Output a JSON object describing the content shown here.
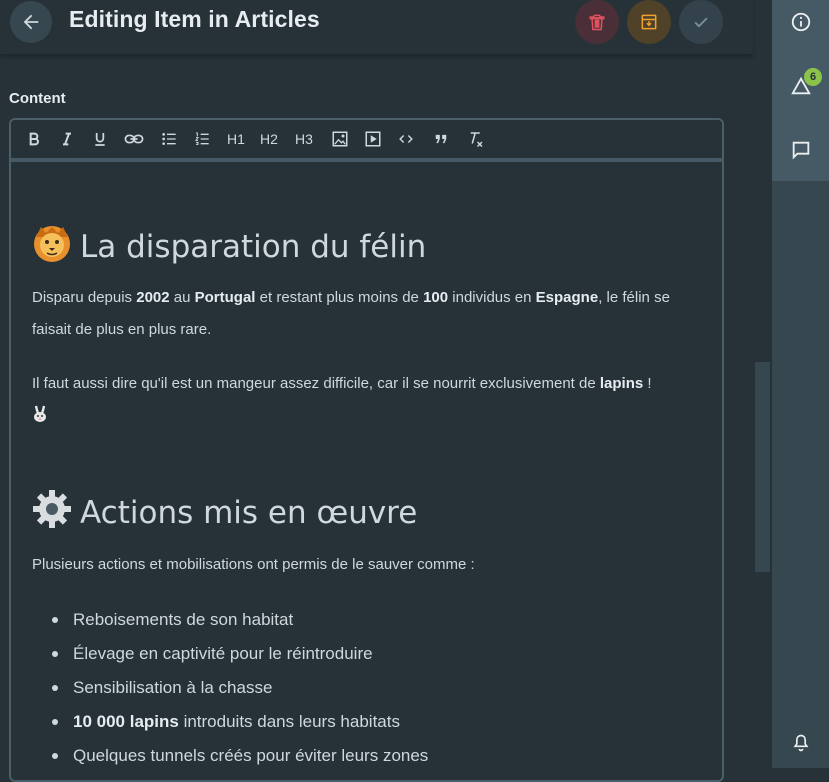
{
  "header": {
    "title": "Editing Item in Articles"
  },
  "sidebar": {
    "notifications_count": "6"
  },
  "content_label": "Content",
  "toolbar": {
    "h1": "H1",
    "h2": "H2",
    "h3": "H3"
  },
  "doc": {
    "section1": {
      "emoji": "lion-face-emoji",
      "heading": "La disparation du félin",
      "p1": [
        "Disparu depuis ",
        "2002",
        " au ",
        "Portugal",
        " et restant plus moins de ",
        "100",
        " individus en ",
        "Espagne",
        ", le félin se faisait de plus en plus rare."
      ],
      "p2": [
        "Il faut aussi dire qu'il est un mangeur assez difficile, car il se nourrit exclusivement de ",
        "lapins",
        " !"
      ],
      "p2_emoji": "rabbit-emoji"
    },
    "section2": {
      "emoji": "gear-emoji",
      "heading": "Actions mis en œuvre",
      "intro": "Plusieurs actions et mobilisations ont permis de le sauver comme :",
      "items": [
        {
          "bold": "",
          "text": "Reboisements de son habitat"
        },
        {
          "bold": "",
          "text": "Élevage en captivité pour le réintroduire"
        },
        {
          "bold": "",
          "text": "Sensibilisation à la chasse"
        },
        {
          "bold": "10 000 lapins",
          "text": " introduits dans leurs habitats"
        },
        {
          "bold": "",
          "text": "Quelques tunnels créés pour éviter leurs zones"
        }
      ]
    }
  },
  "colors": {
    "background": "#263238",
    "sidebar": "#37474f",
    "delete": "#e05260",
    "archive": "#f0a12e",
    "badge": "#8bc34a"
  }
}
